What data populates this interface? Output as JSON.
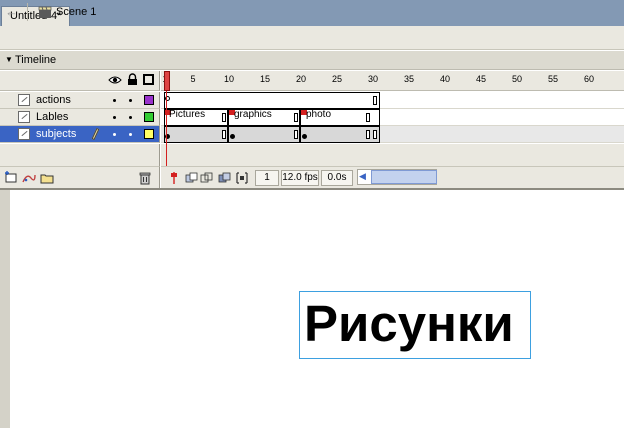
{
  "document": {
    "tab_title": "Untitled-4*"
  },
  "editbar": {
    "scene_label": "Scene 1",
    "back_icon": "back-arrow-icon"
  },
  "timeline": {
    "panel_title": "Timeline",
    "ruler_ticks": [
      "1",
      "5",
      "10",
      "15",
      "20",
      "25",
      "30",
      "35",
      "40",
      "45",
      "50",
      "55",
      "60"
    ],
    "layers": [
      {
        "name": "actions",
        "color": "#9933cc",
        "selected": false
      },
      {
        "name": "Lables",
        "color": "#33cc33",
        "selected": false
      },
      {
        "name": "subjects",
        "color": "#ffff66",
        "selected": true
      }
    ],
    "frame_labels": [
      "Pictures",
      "graphics",
      "photo"
    ],
    "status": {
      "current_frame": "1",
      "fps": "12.0 fps",
      "elapsed": "0.0s"
    }
  },
  "stage": {
    "text": "Рисунки"
  },
  "colors": {
    "selection": "#3a64c4",
    "playhead": "#d42020",
    "text_frame": "#3da0e0"
  }
}
